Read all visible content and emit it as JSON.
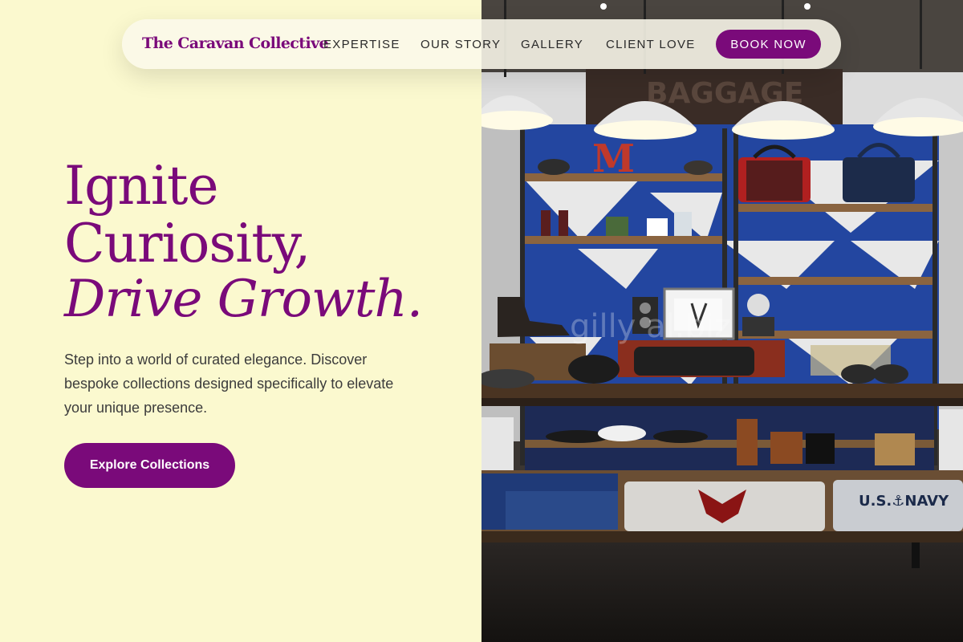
{
  "nav": {
    "brand": "The Caravan Collective",
    "links": [
      {
        "label": "EXPERTISE"
      },
      {
        "label": "OUR STORY"
      },
      {
        "label": "GALLERY"
      },
      {
        "label": "CLIENT LOVE"
      }
    ],
    "book_label": "BOOK NOW"
  },
  "hero": {
    "line1": "Ignite",
    "line2": "Curiosity,",
    "line3": "Drive Growth.",
    "subtext": "Step into a world of curated elegance. Discover bespoke collections designed specifically to elevate your unique presence.",
    "cta_label": "Explore Collections"
  },
  "photo": {
    "sign_text": "BAGGAGE",
    "letter": "M",
    "shirt_text": "U.S.⚓NAVY",
    "watermark": "gilly  al.biz"
  },
  "colors": {
    "accent": "#7a0a7a",
    "background": "#fbf9cf"
  }
}
